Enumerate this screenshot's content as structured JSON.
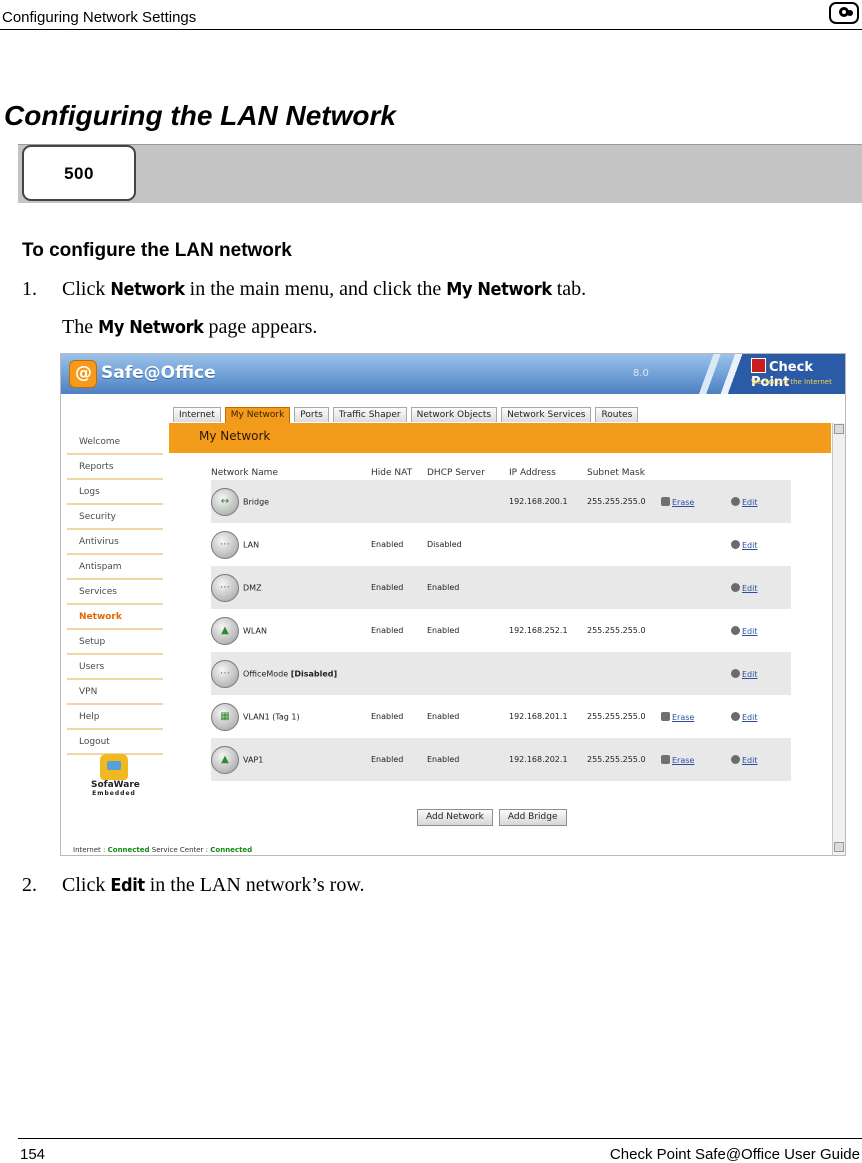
{
  "header": {
    "text": "Configuring Network Settings",
    "logo_icon": "check-point-logo-icon"
  },
  "section_title": "Configuring the LAN Network",
  "model_badge": "500",
  "procedure_heading": "To configure the LAN network",
  "step1": {
    "num": "1.",
    "pre": "Click ",
    "kw1": "Network",
    "mid": " in the main menu, and click the ",
    "kw2": "My Network",
    "post": " tab."
  },
  "result1": {
    "pre": "The ",
    "kw": "My Network",
    "post": " page appears."
  },
  "step2": {
    "num": "2.",
    "pre": "Click ",
    "kw": "Edit",
    "post": " in the LAN network’s row."
  },
  "screenshot": {
    "app_name": "Safe@Office",
    "app_version": "8.0",
    "brand": "Check Point",
    "brand_tagline": "We Secure the Internet",
    "tabs": [
      "Internet",
      "My Network",
      "Ports",
      "Traffic Shaper",
      "Network Objects",
      "Network Services",
      "Routes"
    ],
    "active_tab": "My Network",
    "menu": [
      "Welcome",
      "Reports",
      "Logs",
      "Security",
      "Antivirus",
      "Antispam",
      "Services",
      "Network",
      "Setup",
      "Users",
      "VPN",
      "Help",
      "Logout"
    ],
    "active_menu": "Network",
    "page_title": "My Network",
    "columns": [
      "Network Name",
      "Hide NAT",
      "DHCP Server",
      "IP Address",
      "Subnet Mask"
    ],
    "rows": [
      {
        "name": "Bridge",
        "hide_nat": "",
        "dhcp": "",
        "ip": "192.168.200.1",
        "mask": "255.255.255.0",
        "erase": "Erase",
        "edit": "Edit"
      },
      {
        "name": "LAN",
        "hide_nat": "Enabled",
        "dhcp": "Disabled",
        "ip": "",
        "mask": "",
        "erase": "",
        "edit": "Edit"
      },
      {
        "name": "DMZ",
        "hide_nat": "Enabled",
        "dhcp": "Enabled",
        "ip": "",
        "mask": "",
        "erase": "",
        "edit": "Edit"
      },
      {
        "name": "WLAN",
        "hide_nat": "Enabled",
        "dhcp": "Enabled",
        "ip": "192.168.252.1",
        "mask": "255.255.255.0",
        "erase": "",
        "edit": "Edit"
      },
      {
        "name": "OfficeMode",
        "name_suffix": "[Disabled]",
        "hide_nat": "",
        "dhcp": "",
        "ip": "",
        "mask": "",
        "erase": "",
        "edit": "Edit"
      },
      {
        "name": "VLAN1 (Tag 1)",
        "hide_nat": "Enabled",
        "dhcp": "Enabled",
        "ip": "192.168.201.1",
        "mask": "255.255.255.0",
        "erase": "Erase",
        "edit": "Edit"
      },
      {
        "name": "VAP1",
        "hide_nat": "Enabled",
        "dhcp": "Enabled",
        "ip": "192.168.202.1",
        "mask": "255.255.255.0",
        "erase": "Erase",
        "edit": "Edit"
      }
    ],
    "buttons": {
      "add_network": "Add Network",
      "add_bridge": "Add Bridge"
    },
    "status": {
      "internet_label": "Internet :",
      "internet_value": "Connected",
      "service_label": "Service Center :",
      "service_value": "Connected"
    },
    "sofaware": {
      "name": "SofaWare",
      "sub": "Embedded"
    }
  },
  "footer": {
    "page_number": "154",
    "doc_title": "Check Point Safe@Office User Guide"
  }
}
